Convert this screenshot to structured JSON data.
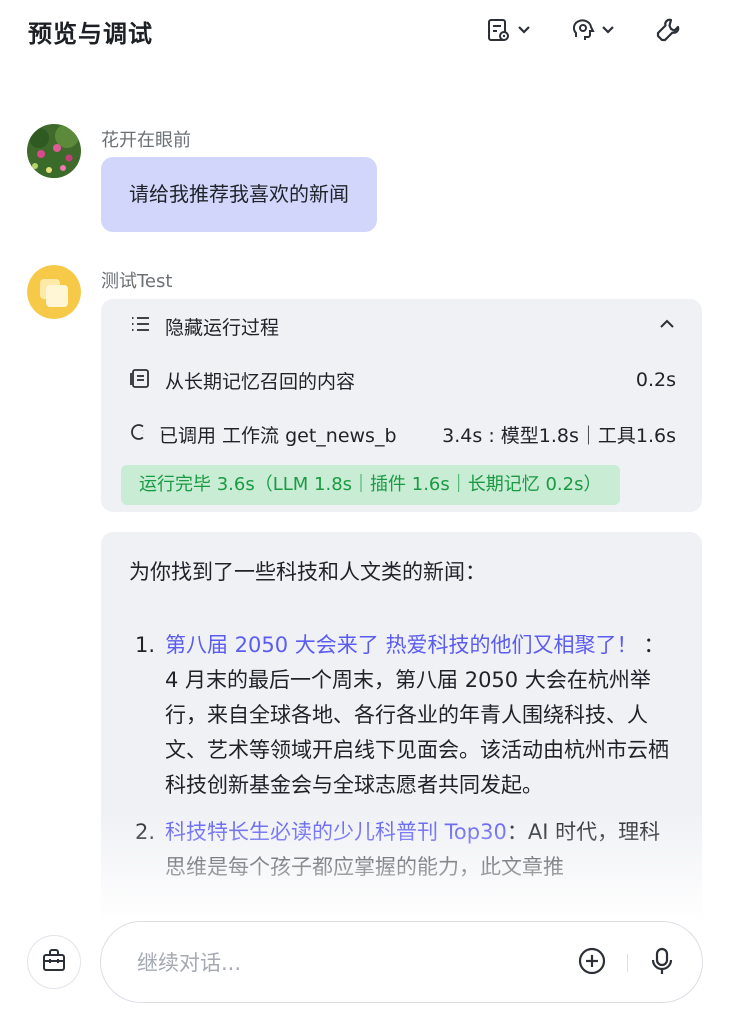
{
  "header": {
    "title": "预览与调试",
    "buttons": [
      {
        "icon": "document-settings-icon"
      },
      {
        "icon": "memory-head-icon"
      },
      {
        "icon": "wrench-icon"
      }
    ]
  },
  "messages": {
    "user": {
      "name": "花开在眼前",
      "text": "请给我推荐我喜欢的新闻"
    },
    "bot": {
      "name": "测试Test",
      "process": {
        "toggle_label": "隐藏运行过程",
        "steps": [
          {
            "label": "从长期记忆召回的内容",
            "time": "0.2s",
            "icon": "document-list-icon"
          },
          {
            "label": "已调用 工作流 get_news_b",
            "time": "3.4s : 模型1.8s｜工具1.6s",
            "icon": "workflow-icon"
          }
        ],
        "status": "运行完毕 3.6s（LLM 1.8s｜插件 1.6s｜长期记忆 0.2s）"
      },
      "answer": {
        "intro": "为你找到了一些科技和人文类的新闻：",
        "items": [
          {
            "num": "1.",
            "title": "第八届 2050 大会来了 热爱科技的他们又相聚了！",
            "sep": "：",
            "desc": "4 月末的最后一个周末，第八届 2050 大会在杭州举行，来自全球各地、各行各业的年青人围绕科技、人文、艺术等领域开启线下见面会。该活动由杭州市云栖科技创新基金会与全球志愿者共同发起。"
          },
          {
            "num": "2.",
            "title": "科技特长生必读的少儿科普刊 Top30",
            "sep": "：",
            "desc": "AI 时代，理科思维是每个孩子都应掌握的能力，此文章推"
          }
        ]
      }
    }
  },
  "input": {
    "placeholder": "继续对话..."
  },
  "colors": {
    "user_bubble": "#d3d6fb",
    "panel_bg": "#f0f1f5",
    "link": "#5b5cf0",
    "status_bg": "#c9ecd5",
    "status_text": "#1a9a43",
    "bot_avatar": "#f7c948"
  }
}
